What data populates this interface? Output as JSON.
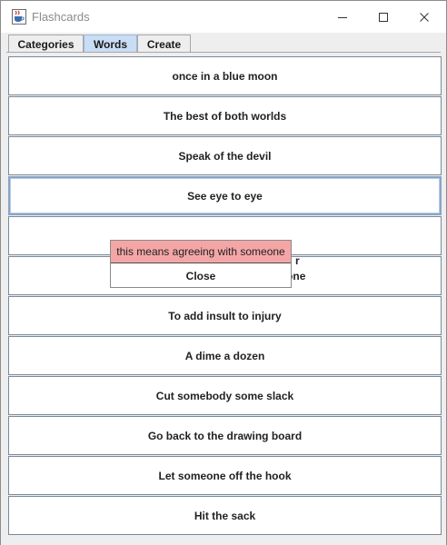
{
  "window": {
    "title": "Flashcards",
    "icon": "java-coffee-cup-icon"
  },
  "titlebar_controls": {
    "minimize_icon": "minimize-icon",
    "maximize_icon": "maximize-icon",
    "close_icon": "close-icon"
  },
  "tabs": [
    {
      "label": "Categories",
      "active": false
    },
    {
      "label": "Words",
      "active": true
    },
    {
      "label": "Create",
      "active": false
    }
  ],
  "cards": [
    {
      "label": "once in a blue moon"
    },
    {
      "label": "The best of both worlds"
    },
    {
      "label": "Speak of the devil"
    },
    {
      "label": "See eye to eye",
      "focused": true
    },
    {
      "label": "",
      "obscured_suffix": "r"
    },
    {
      "label": "To kill two birds with one stone"
    },
    {
      "label": "To add insult to injury"
    },
    {
      "label": "A dime a dozen"
    },
    {
      "label": "Cut somebody some slack"
    },
    {
      "label": "Go back to the drawing board"
    },
    {
      "label": "Let someone off the hook"
    },
    {
      "label": "Hit the sack"
    }
  ],
  "popup": {
    "definition": "this means agreeing with someone",
    "close_label": "Close"
  },
  "colors": {
    "active_tab": "#c9ddf4",
    "popup_highlight": "#f4a6a6",
    "card_border": "#7a8a99"
  }
}
